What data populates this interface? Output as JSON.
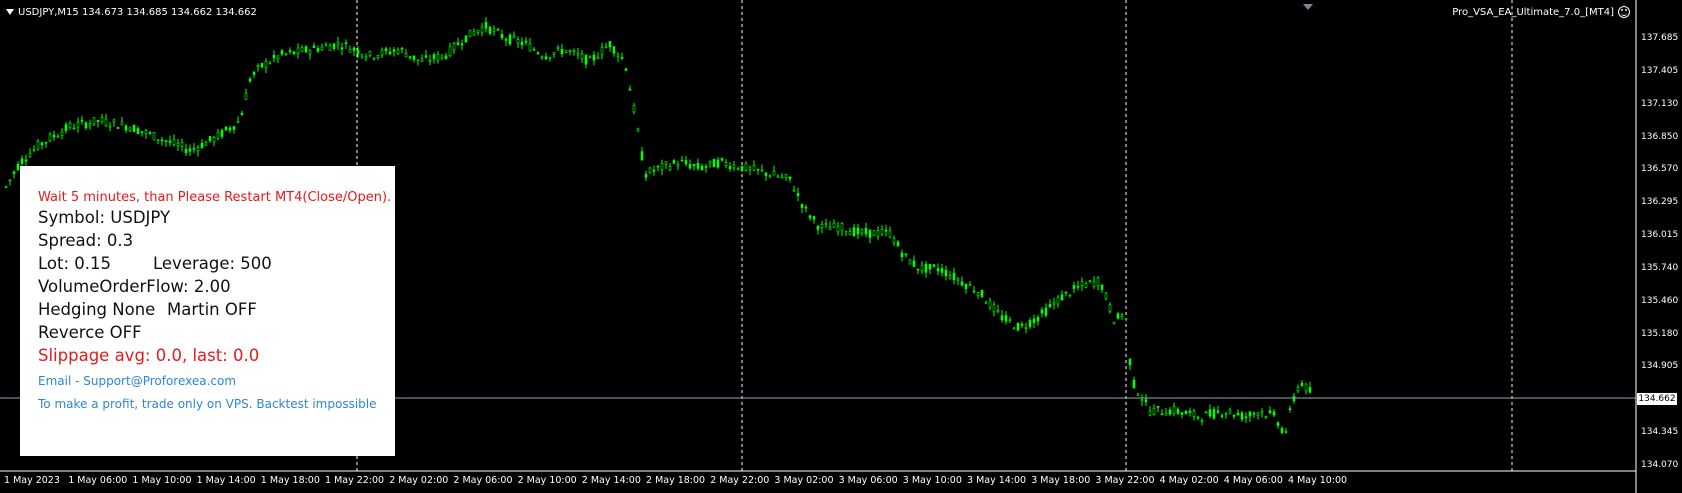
{
  "header": {
    "title": "USDJPY,M15  134.673 134.685 134.662 134.662",
    "ea_name": "Pro_VSA_EA_Ultimate_7.0_[MT4]"
  },
  "panel": {
    "warning": "Wait 5 minutes, than Please Restart MT4(Close/Open).",
    "symbol": "Symbol: USDJPY",
    "spread": "Spread: 0.3",
    "lot": "Lot: 0.15",
    "leverage": "Leverage: 500",
    "volume_flow": "VolumeOrderFlow: 2.00",
    "hedging": "Hedging None",
    "martin": "Martin OFF",
    "reverse": "Reverce OFF",
    "slippage": "Slippage avg: 0.0, last: 0.0",
    "email": "Email - Support@Proforexea.com",
    "note": "To make a profit, trade only on VPS. Backtest impossible"
  },
  "current_price": "134.662",
  "colors": {
    "background": "#000000",
    "candles": "#00ff00",
    "grid": "#ffffff",
    "price_line": "#8fa6b8",
    "warning_text": "#e8191a",
    "info_text": "#2e86d6"
  },
  "y_axis": {
    "labels": [
      "137.685",
      "137.405",
      "137.130",
      "136.850",
      "136.570",
      "136.295",
      "136.015",
      "135.740",
      "135.460",
      "135.180",
      "134.905",
      "134.345",
      "134.070"
    ]
  },
  "x_axis": {
    "labels": [
      "1 May 2023",
      "1 May 06:00",
      "1 May 10:00",
      "1 May 14:00",
      "1 May 18:00",
      "1 May 22:00",
      "2 May 02:00",
      "2 May 06:00",
      "2 May 10:00",
      "2 May 14:00",
      "2 May 18:00",
      "2 May 22:00",
      "3 May 02:00",
      "3 May 06:00",
      "3 May 10:00",
      "3 May 14:00",
      "3 May 18:00",
      "3 May 22:00",
      "4 May 02:00",
      "4 May 06:00",
      "4 May 10:00"
    ]
  },
  "chart_data": {
    "type": "line",
    "ylim": [
      134.0,
      137.8
    ],
    "price_path": [
      [
        0,
        136.3
      ],
      [
        20,
        136.6
      ],
      [
        40,
        136.75
      ],
      [
        70,
        136.9
      ],
      [
        100,
        136.95
      ],
      [
        130,
        136.9
      ],
      [
        160,
        136.8
      ],
      [
        190,
        136.7
      ],
      [
        215,
        136.8
      ],
      [
        240,
        136.95
      ],
      [
        250,
        137.3
      ],
      [
        260,
        137.4
      ],
      [
        280,
        137.5
      ],
      [
        310,
        137.55
      ],
      [
        340,
        137.6
      ],
      [
        370,
        137.5
      ],
      [
        400,
        137.55
      ],
      [
        420,
        137.45
      ],
      [
        445,
        137.5
      ],
      [
        465,
        137.65
      ],
      [
        485,
        137.75
      ],
      [
        505,
        137.65
      ],
      [
        525,
        137.6
      ],
      [
        545,
        137.5
      ],
      [
        565,
        137.55
      ],
      [
        590,
        137.45
      ],
      [
        610,
        137.6
      ],
      [
        625,
        137.45
      ],
      [
        635,
        137.0
      ],
      [
        645,
        136.5
      ],
      [
        660,
        136.55
      ],
      [
        680,
        136.6
      ],
      [
        700,
        136.55
      ],
      [
        720,
        136.6
      ],
      [
        745,
        136.55
      ],
      [
        770,
        136.5
      ],
      [
        790,
        136.45
      ],
      [
        805,
        136.2
      ],
      [
        820,
        136.05
      ],
      [
        840,
        136.05
      ],
      [
        860,
        136.0
      ],
      [
        890,
        136.0
      ],
      [
        905,
        135.8
      ],
      [
        920,
        135.7
      ],
      [
        940,
        135.7
      ],
      [
        960,
        135.6
      ],
      [
        980,
        135.5
      ],
      [
        1000,
        135.3
      ],
      [
        1020,
        135.2
      ],
      [
        1040,
        135.3
      ],
      [
        1060,
        135.45
      ],
      [
        1080,
        135.55
      ],
      [
        1100,
        135.6
      ],
      [
        1115,
        135.25
      ],
      [
        1125,
        135.35
      ],
      [
        1132,
        134.75
      ],
      [
        1150,
        134.5
      ],
      [
        1175,
        134.5
      ],
      [
        1200,
        134.45
      ],
      [
        1225,
        134.5
      ],
      [
        1245,
        134.45
      ],
      [
        1260,
        134.5
      ],
      [
        1275,
        134.45
      ],
      [
        1285,
        134.3
      ],
      [
        1292,
        134.55
      ],
      [
        1300,
        134.75
      ],
      [
        1310,
        134.66
      ]
    ]
  }
}
